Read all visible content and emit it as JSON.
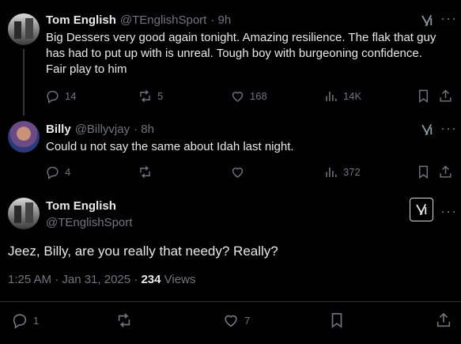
{
  "post1": {
    "author_name": "Tom English",
    "author_handle": "@TEnglishSport",
    "age": "· 9h",
    "text_lines": [
      "Big Dessers very good again tonight. Amazing resilience. The flak that guy",
      "has had to put up with is unreal. Tough boy with burgeoning confidence.",
      "Fair play to him"
    ],
    "replies": "14",
    "reposts": "5",
    "likes": "168",
    "views": "14K"
  },
  "post2": {
    "author_name": "Billy",
    "author_handle": "@Billyvjay",
    "age": "· 8h",
    "text": "Could u not say the same about Idah last night.",
    "replies": "4",
    "reposts": "",
    "likes": "",
    "views": "372"
  },
  "main_post": {
    "author_name": "Tom English",
    "author_handle": "@TEnglishSport",
    "text": "Jeez, Billy, are you really that needy? Really?",
    "timestamp": "1:25 AM · Jan 31, 2025 · ",
    "views_count": "234",
    "views_label": " Views",
    "replies": "1",
    "reposts": "",
    "likes": "7"
  },
  "icons": [
    "grok-icon",
    "more-icon",
    "reply-icon",
    "repost-icon",
    "like-icon",
    "views-icon",
    "bookmark-icon",
    "share-icon"
  ]
}
